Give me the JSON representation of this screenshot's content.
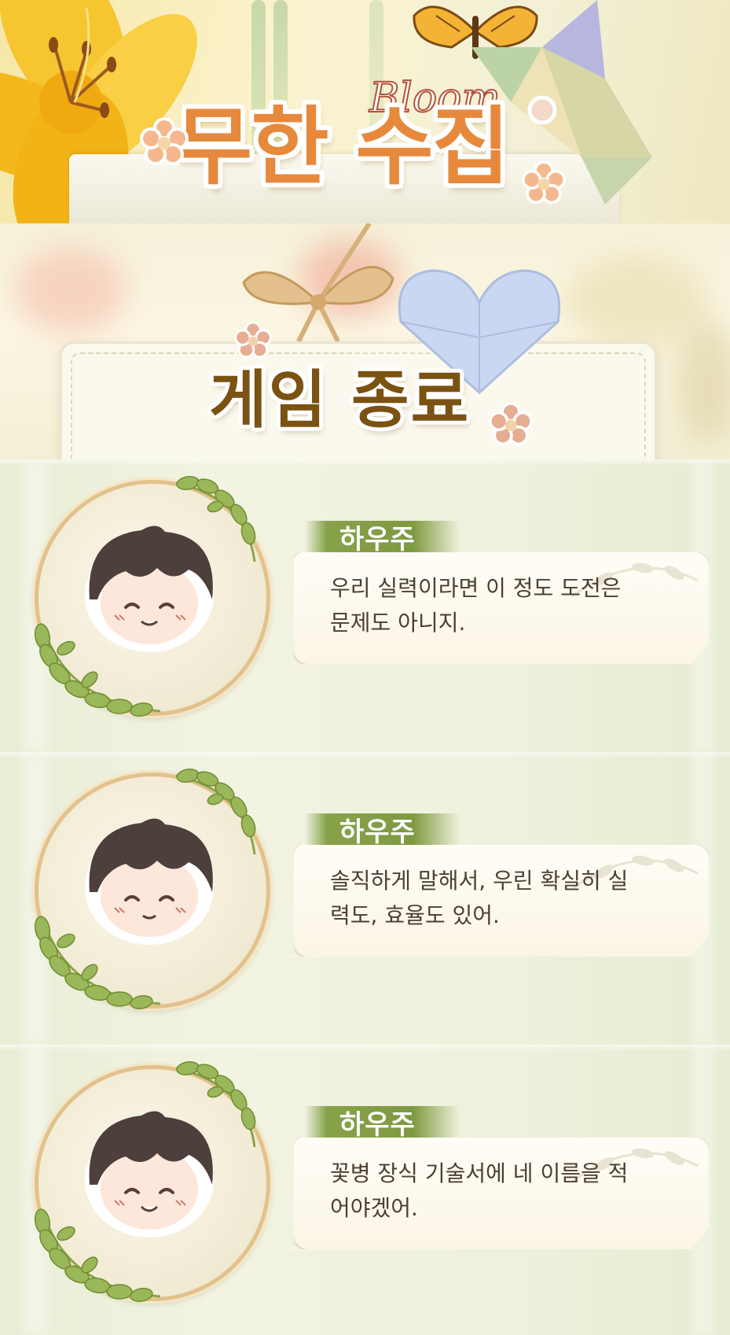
{
  "banner_title": {
    "title": "무한 수집",
    "logo_word": "Bloom"
  },
  "banner_end": {
    "title": "게임 종료"
  },
  "dialogues": [
    {
      "speaker": "하우주",
      "text": "우리 실력이라면 이 정도 도전은\n문제도 아니지."
    },
    {
      "speaker": "하우주",
      "text": "솔직하게 말해서, 우린 확실히 실\n력도, 효율도 있어."
    },
    {
      "speaker": "하우주",
      "text": "꽃병 장식 기술서에 네 이름을 적\n어야겠어."
    }
  ],
  "colors": {
    "title_orange": "#e7893c",
    "end_title_brown": "#7a5212",
    "name_tag_green": "#7e9a41",
    "frame_gold": "#e2c28c",
    "text_dark": "#4b3f33"
  },
  "icons": [
    "lily-flower-icon",
    "butterfly-icon",
    "origami-pinwheel-icon",
    "ribbon-bow-icon",
    "origami-heart-icon",
    "leaf-wreath-icon",
    "small-flower-icon"
  ]
}
